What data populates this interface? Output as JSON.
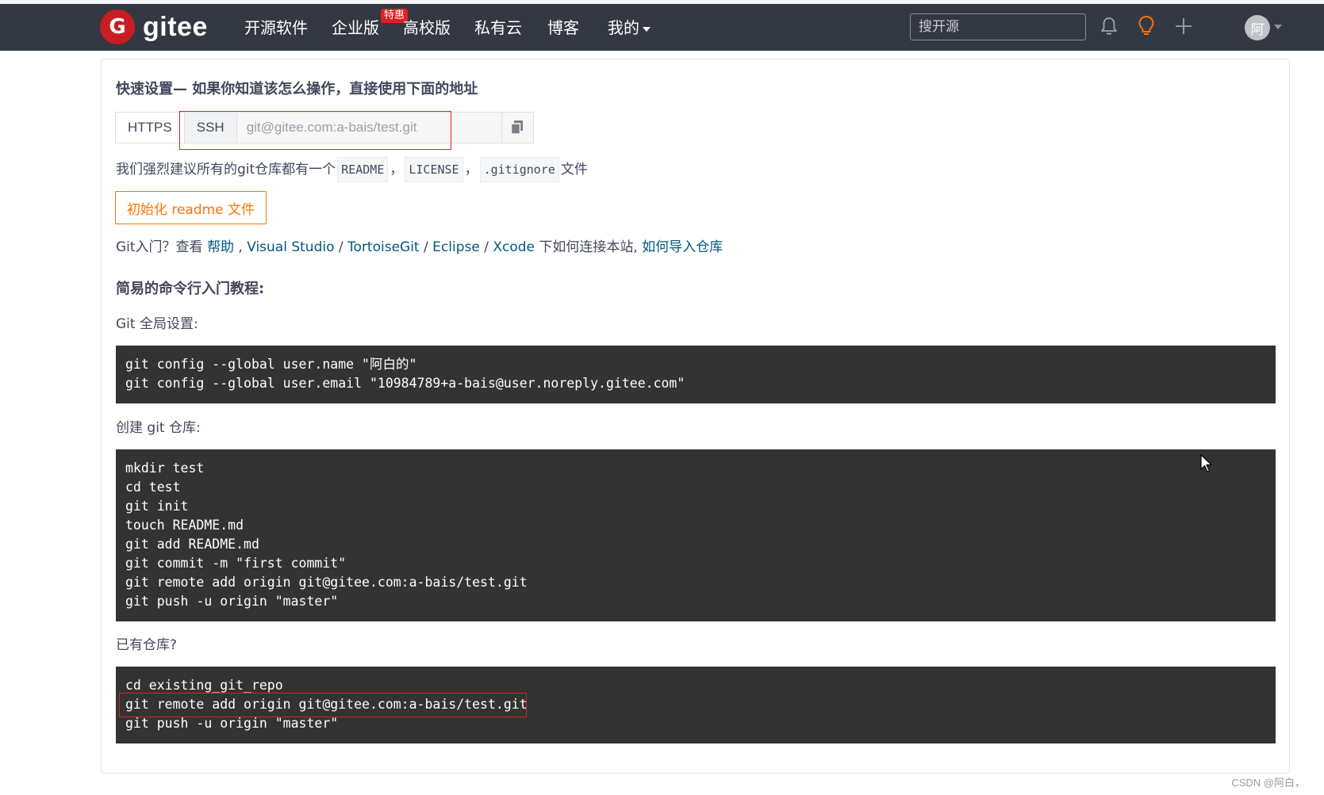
{
  "nav": {
    "logo_text": "gitee",
    "items": [
      "开源软件",
      "企业版",
      "高校版",
      "私有云",
      "博客",
      "我的"
    ],
    "badge": "特惠",
    "search_placeholder": "搜开源",
    "avatar_text": "阿"
  },
  "quick_setup": {
    "title": "快速设置— 如果你知道该怎么操作，直接使用下面的地址",
    "https_label": "HTTPS",
    "ssh_label": "SSH",
    "url_value": "git@gitee.com:a-bais/test.git",
    "active_protocol": "SSH"
  },
  "recommend": {
    "prefix": "我们强烈建议所有的git仓库都有一个",
    "files": [
      "README",
      "LICENSE",
      ".gitignore"
    ],
    "sep": "，",
    "suffix": "文件"
  },
  "init_button_label": "初始化 readme 文件",
  "getting_started": {
    "prefix": "Git入门？查看 ",
    "help_link": "帮助",
    "sep1": " , ",
    "visual_studio": "Visual Studio",
    "slash": " / ",
    "tortoisegit": "TortoiseGit",
    "eclipse": "Eclipse",
    "xcode": "Xcode",
    "middle": " 下如何连接本站, ",
    "import_link": "如何导入仓库"
  },
  "tutorial": {
    "title": "简易的命令行入门教程:",
    "global_label": "Git 全局设置:",
    "global_cmds": [
      "git config --global user.name \"阿白的\"",
      "git config --global user.email \"10984789+a-bais@user.noreply.gitee.com\""
    ],
    "create_label": "创建 git 仓库:",
    "create_cmds": [
      "mkdir test",
      "cd test",
      "git init",
      "touch README.md",
      "git add README.md",
      "git commit -m \"first commit\"",
      "git remote add origin git@gitee.com:a-bais/test.git",
      "git push -u origin \"master\""
    ],
    "existing_label": "已有仓库?",
    "existing_cmds": [
      "cd existing_git_repo",
      "git remote add origin git@gitee.com:a-bais/test.git",
      "git push -u origin \"master\""
    ]
  },
  "watermark": "CSDN @阿白，",
  "colors": {
    "nav_bg": "#333843",
    "brand_red": "#c71d23",
    "accent_orange": "#fe7300",
    "link_blue": "#005980",
    "code_bg": "#333333",
    "highlight_red": "#e02020"
  },
  "icons": [
    "bell-icon",
    "lightbulb-icon",
    "plus-icon",
    "copy-icon",
    "chevron-down-icon",
    "mouse-cursor-icon"
  ]
}
